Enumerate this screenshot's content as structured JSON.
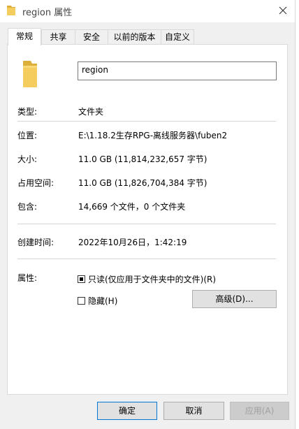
{
  "window": {
    "title": "region 属性",
    "title_icon": "folder-icon",
    "close_icon": "close-icon"
  },
  "tabs": [
    {
      "label": "常规",
      "active": true
    },
    {
      "label": "共享",
      "active": false
    },
    {
      "label": "安全",
      "active": false
    },
    {
      "label": "以前的版本",
      "active": false
    },
    {
      "label": "自定义",
      "active": false
    }
  ],
  "general": {
    "folder_name": "region",
    "type_label": "类型:",
    "type_value": "文件夹",
    "location_label": "位置:",
    "location_value": "E:\\1.18.2生存RPG-离线服务器\\fuben2",
    "size_label": "大小:",
    "size_value": "11.0 GB (11,814,232,657 字节)",
    "disk_size_label": "占用空间:",
    "disk_size_value": "11.0 GB (11,826,704,384 字节)",
    "contains_label": "包含:",
    "contains_value": "14,669 个文件，0 个文件夹",
    "created_label": "创建时间:",
    "created_value": "2022年10月26日，1:42:19",
    "attributes_label": "属性:",
    "readonly_label": "只读(仅应用于文件夹中的文件)(R)",
    "readonly_state": "indeterminate",
    "hidden_label": "隐藏(H)",
    "hidden_checked": false,
    "advanced_button": "高级(D)..."
  },
  "footer": {
    "ok": "确定",
    "cancel": "取消",
    "apply": "应用(A)"
  },
  "colors": {
    "folder": "#f0c55a",
    "accent": "#0078d7",
    "dialog_bg": "#f0f0f0"
  }
}
